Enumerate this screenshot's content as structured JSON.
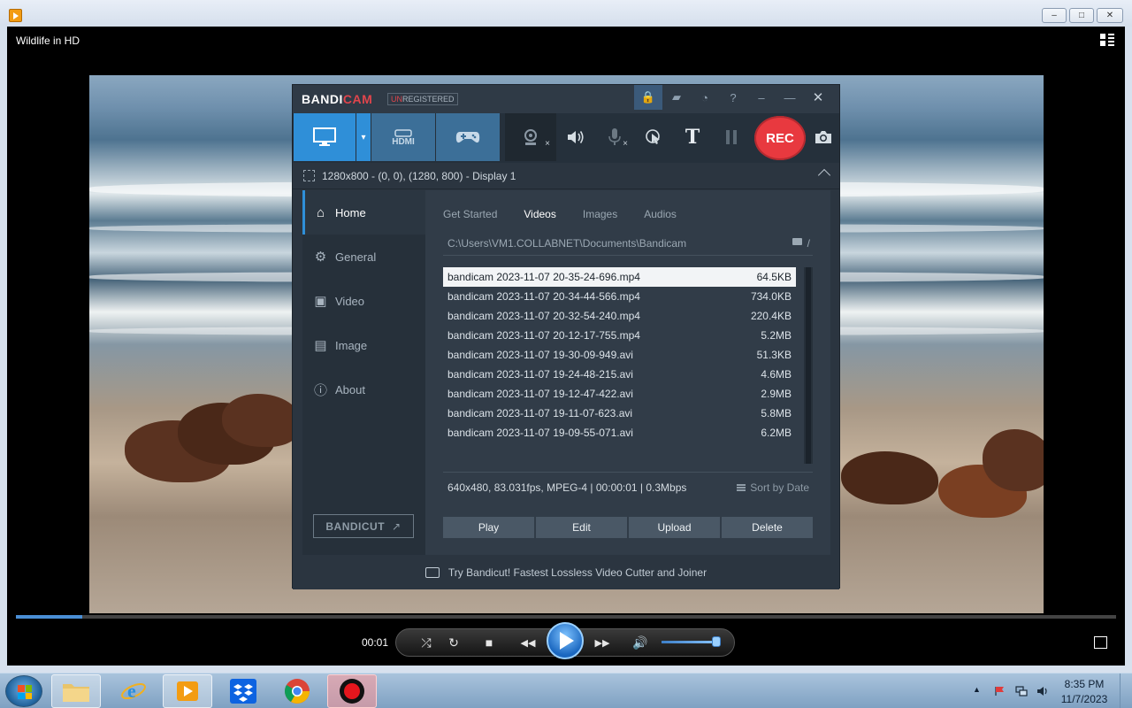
{
  "window": {
    "title": "Wildlife in HD",
    "controls": {
      "minimize": "–",
      "maximize": "□",
      "close": "✕"
    }
  },
  "bandicam": {
    "logo_a": "BANDI",
    "logo_b": "CAM",
    "unregistered_a": "UN",
    "unregistered_b": "REGISTERED",
    "modes": [
      {
        "name": "screen-recording-mode",
        "icon": "monitor-icon"
      },
      {
        "name": "device-recording-mode",
        "label": "HDMI",
        "icon": "hdmi-icon"
      },
      {
        "name": "game-recording-mode",
        "icon": "gamepad-icon"
      }
    ],
    "tools": [
      {
        "icon": "webcam-icon",
        "badge": "×"
      },
      {
        "icon": "speaker-icon"
      },
      {
        "icon": "microphone-icon",
        "badge": "×"
      },
      {
        "icon": "cursor-click-icon"
      },
      {
        "label": "T",
        "icon": "text-icon"
      }
    ],
    "rec_label": "REC",
    "display": "1280x800 - (0, 0), (1280, 800) - Display 1",
    "sidebar": [
      {
        "label": "Home",
        "icon": "home-icon",
        "active": true
      },
      {
        "label": "General",
        "icon": "gear-icon"
      },
      {
        "label": "Video",
        "icon": "video-settings-icon"
      },
      {
        "label": "Image",
        "icon": "image-settings-icon"
      },
      {
        "label": "About",
        "icon": "info-icon"
      }
    ],
    "bandicut_label": "BANDICUT",
    "bandicut_arrow": "↗",
    "tabs": [
      "Get Started",
      "Videos",
      "Images",
      "Audios"
    ],
    "active_tab": "Videos",
    "path": "C:\\Users\\VM1.COLLABNET\\Documents\\Bandicam",
    "path_slash": "/",
    "files": [
      {
        "name": "bandicam 2023-11-07 20-35-24-696.mp4",
        "size": "64.5KB",
        "selected": true
      },
      {
        "name": "bandicam 2023-11-07 20-34-44-566.mp4",
        "size": "734.0KB"
      },
      {
        "name": "bandicam 2023-11-07 20-32-54-240.mp4",
        "size": "220.4KB"
      },
      {
        "name": "bandicam 2023-11-07 20-12-17-755.mp4",
        "size": "5.2MB"
      },
      {
        "name": "bandicam 2023-11-07 19-30-09-949.avi",
        "size": "51.3KB"
      },
      {
        "name": "bandicam 2023-11-07 19-24-48-215.avi",
        "size": "4.6MB"
      },
      {
        "name": "bandicam 2023-11-07 19-12-47-422.avi",
        "size": "2.9MB"
      },
      {
        "name": "bandicam 2023-11-07 19-11-07-623.avi",
        "size": "5.8MB"
      },
      {
        "name": "bandicam 2023-11-07 19-09-55-071.avi",
        "size": "6.2MB"
      }
    ],
    "file_info": "640x480, 83.031fps, MPEG-4 | 00:00:01 | 0.3Mbps",
    "sort_label": "Sort by Date",
    "actions": [
      "Play",
      "Edit",
      "Upload",
      "Delete"
    ],
    "promo": "Try Bandicut! Fastest Lossless Video Cutter and Joiner"
  },
  "player": {
    "time": "00:01",
    "progress_fraction": 0.06,
    "volume_fraction": 0.9,
    "controls": [
      {
        "name": "shuffle-button",
        "icon": "shuffle-icon",
        "glyph": "⤮"
      },
      {
        "name": "repeat-button",
        "icon": "repeat-icon",
        "glyph": "↻"
      },
      {
        "name": "stop-button",
        "icon": "stop-icon",
        "glyph": "■"
      },
      {
        "name": "previous-button",
        "icon": "rewind-icon",
        "glyph": "◀◀"
      },
      {
        "name": "next-button",
        "icon": "fast-forward-icon",
        "glyph": "▶▶"
      },
      {
        "name": "mute-button",
        "icon": "volume-icon",
        "glyph": "🔊"
      }
    ]
  },
  "taskbar": {
    "apps": [
      {
        "name": "windows-explorer",
        "icon": "folder-icon",
        "active": true
      },
      {
        "name": "internet-explorer",
        "icon": "ie-icon"
      },
      {
        "name": "windows-media-player",
        "icon": "media-player-icon",
        "active": true
      },
      {
        "name": "dropbox",
        "icon": "dropbox-icon"
      },
      {
        "name": "chrome",
        "icon": "chrome-icon"
      },
      {
        "name": "bandicam",
        "icon": "bandicam-record-icon",
        "active": true
      }
    ],
    "time": "8:35 PM",
    "date": "11/7/2023",
    "tray_arrow": "▲"
  },
  "colors": {
    "accent": "#2f8fd8",
    "rec": "#e8393f",
    "panel": "#2b3540",
    "selected_row": "#f2f4f6"
  }
}
